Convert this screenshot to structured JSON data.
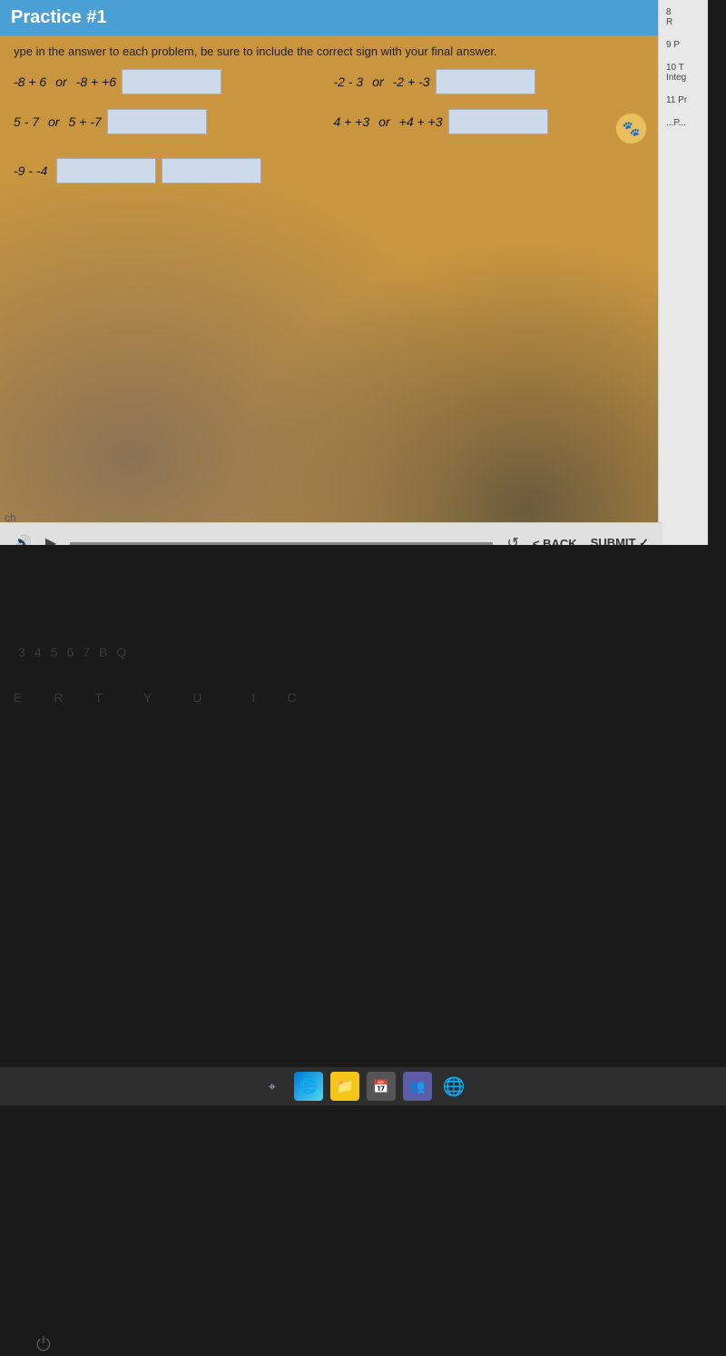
{
  "title": "Practice #1",
  "instruction": "ype in the answer to each problem, be sure to include the correct sign with your final answer.",
  "problems": [
    {
      "id": "p1",
      "left_expression": "-8 + 6",
      "or_text": "or",
      "right_expression": "-8 + +6",
      "answer": ""
    },
    {
      "id": "p2",
      "left_expression": "-2 - 3",
      "or_text": "or",
      "right_expression": "-2 + -3",
      "answer": ""
    },
    {
      "id": "p3",
      "left_expression": "5 - 7",
      "or_text": "or",
      "right_expression": "5 + -7",
      "answer": ""
    },
    {
      "id": "p4",
      "left_expression": "4 + +3",
      "or_text": "or",
      "right_expression": "+4 + +3",
      "answer": ""
    },
    {
      "id": "p5",
      "left_expression": "-9 - -4",
      "or_text": "",
      "right_expression": "",
      "answer": ""
    }
  ],
  "submit_label": "SUBMIT",
  "back_label": "< BACK",
  "submit_checkmark": "✓",
  "sidebar_items": [
    {
      "label": "8 R"
    },
    {
      "label": "9 P"
    },
    {
      "label": "10 T\nInteg"
    },
    {
      "label": "11 Pr"
    },
    {
      "label": "...P..."
    }
  ],
  "controls": {
    "volume_icon": "🔊",
    "play_icon": "▶",
    "refresh_icon": "↺",
    "back_label": "< BACK",
    "submit_label": "SUBMIT ✓"
  },
  "taskbar": {
    "icons": [
      "⌖",
      "🌐",
      "📁",
      "📅",
      "👥",
      "🌐"
    ]
  },
  "footer_label": "ch"
}
